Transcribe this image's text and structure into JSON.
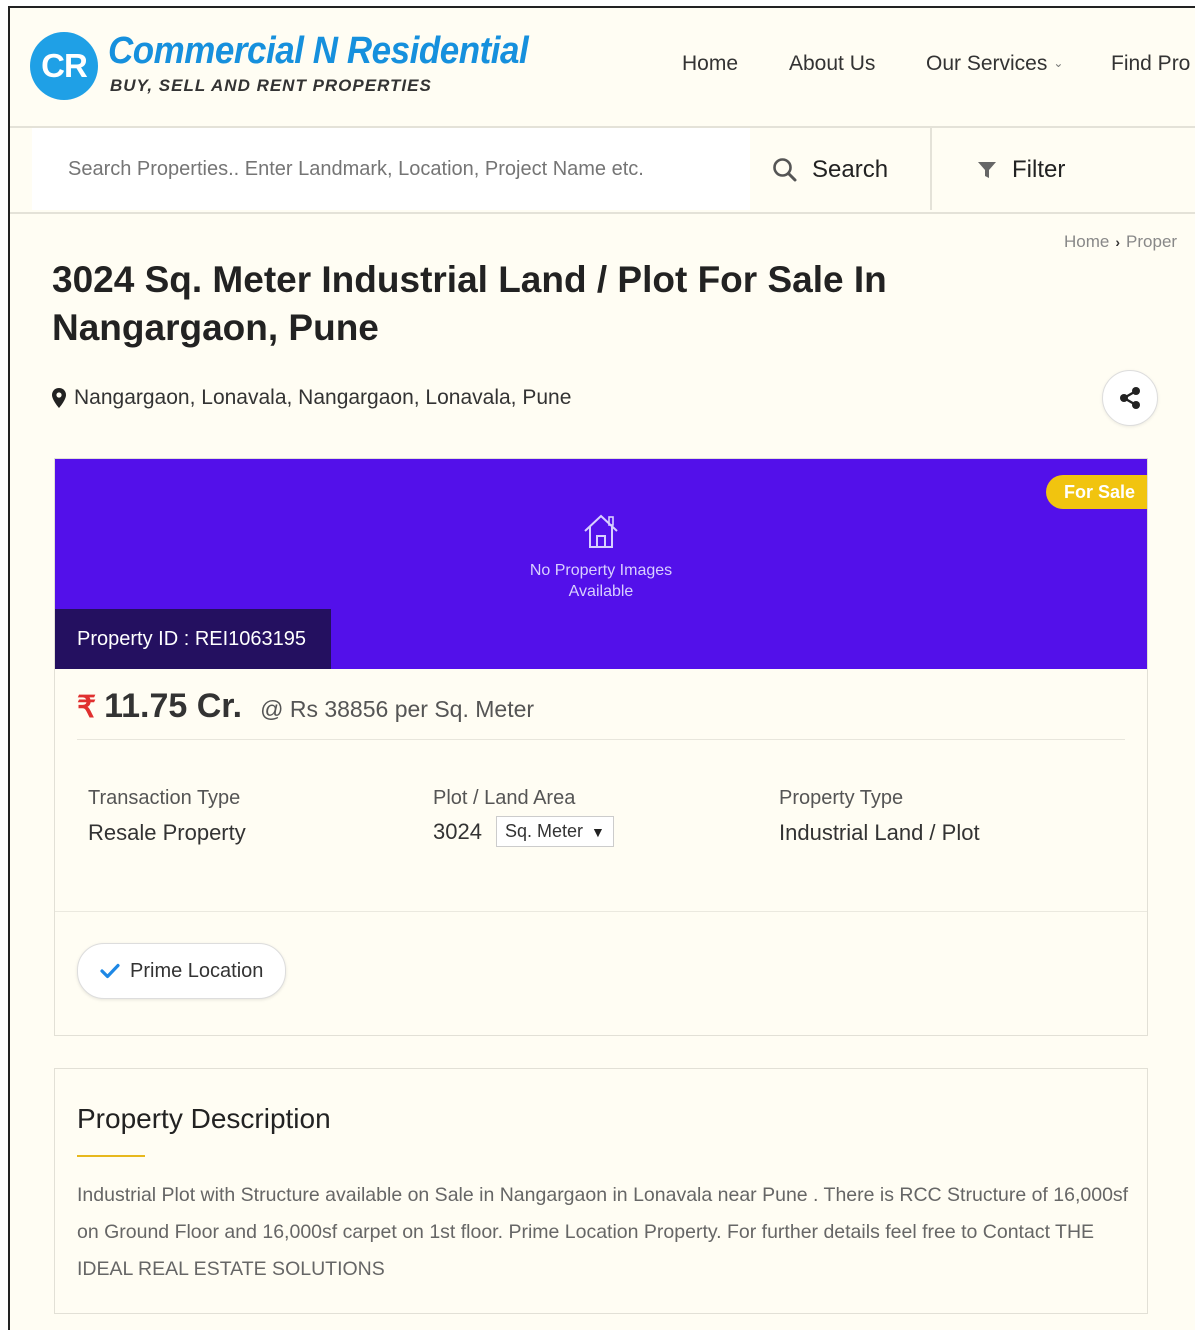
{
  "header": {
    "logo_badge": "CR",
    "logo_title": "Commercial N Residential",
    "logo_tagline": "BUY, SELL AND RENT PROPERTIES",
    "nav": {
      "home": "Home",
      "about": "About Us",
      "services": "Our Services",
      "find": "Find Pro"
    }
  },
  "search": {
    "placeholder": "Search Properties.. Enter Landmark, Location, Project Name etc.",
    "search_label": "Search",
    "filter_label": "Filter"
  },
  "breadcrumb": {
    "home": "Home",
    "current": "Proper"
  },
  "property": {
    "title": "3024 Sq. Meter Industrial Land / Plot For Sale In Nangargaon, Pune",
    "location": "Nangargaon, Lonavala, Nangargaon, Lonavala, Pune",
    "status_badge": "For Sale",
    "no_image_line1": "No Property Images",
    "no_image_line2": "Available",
    "property_id": "Property ID : REI1063195",
    "currency_symbol": "₹",
    "price": "11.75 Cr.",
    "price_per_unit": "@ Rs 38856 per Sq. Meter",
    "facts": {
      "transaction_label": "Transaction Type",
      "transaction_value": "Resale Property",
      "area_label": "Plot / Land Area",
      "area_value": "3024",
      "area_unit": "Sq. Meter",
      "type_label": "Property Type",
      "type_value": "Industrial Land / Plot"
    },
    "feature": "Prime Location"
  },
  "description": {
    "title": "Property Description",
    "text": "Industrial Plot with Structure available on Sale in Nangargaon in Lonavala near Pune . There is RCC Structure of 16,000sf on Ground Floor and 16,000sf carpet on 1st floor. Prime Location Property. For further details feel free to Contact THE IDEAL REAL ESTATE SOLUTIONS"
  },
  "colors": {
    "brand_blue": "#1690dd",
    "hero_purple": "#5310ea",
    "badge_yellow": "#f1c40f",
    "rupee_red": "#e0302f",
    "check_blue": "#1e88e5",
    "accent_gold": "#e7b81d"
  }
}
